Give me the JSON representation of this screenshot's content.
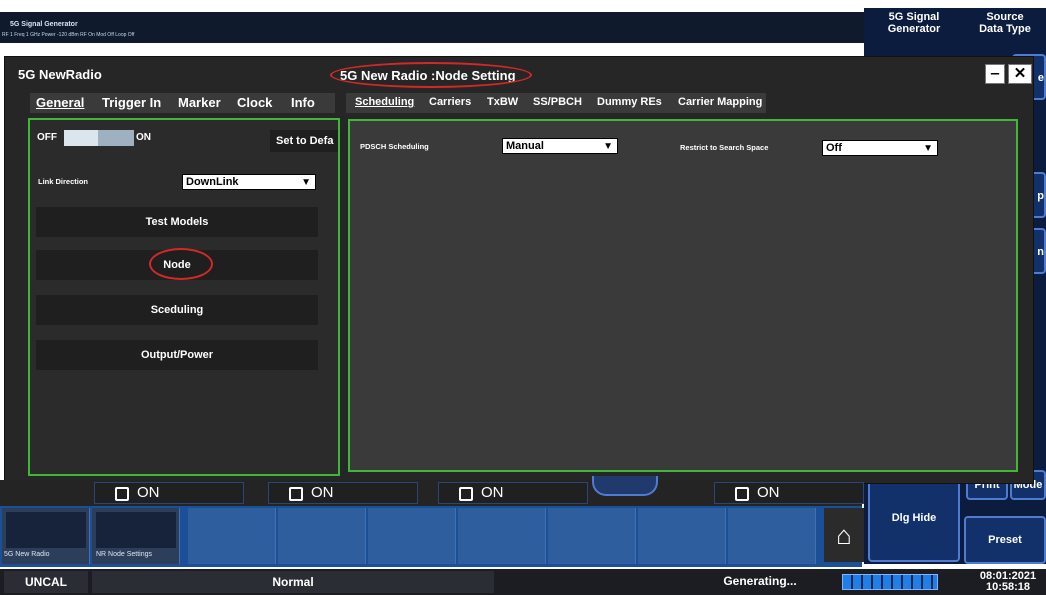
{
  "header": {
    "window_label": "5G Signal Generator",
    "status_line": "RF 1 Freq 1 GHz Power -120 dBm RF On Mod Off Loop Off"
  },
  "right_panel": {
    "btn1": "5G Signal\nGenerator",
    "btn2": "Source\nData Type",
    "frag1": "e",
    "frag2": "p",
    "frag3": "n",
    "print": "Print",
    "mode": "Mode",
    "dlg_hide": "Dlg Hide",
    "preset": "Preset"
  },
  "dialog": {
    "title": "5G NewRadio",
    "node_title": "5G New Radio :Node Setting",
    "min_icon": "‒",
    "close_icon": "✕"
  },
  "left_tabs": [
    "General",
    "Trigger In",
    "Marker",
    "Clock",
    "Info"
  ],
  "right_tabs": [
    "Scheduling",
    "Carriers",
    "TxBW",
    "SS/PBCH",
    "Dummy REs",
    "Carrier Mapping"
  ],
  "left_panel": {
    "off": "OFF",
    "on": "ON",
    "set_default": "Set to Defa",
    "link_label": "Link Direction",
    "link_value": "DownLink",
    "test_models": "Test Models",
    "node": "Node",
    "sceduling": "Sceduling",
    "output_power": "Output/Power"
  },
  "right_panel_content": {
    "pdsch_label": "PDSCH Scheduling",
    "pdsch_value": "Manual",
    "restrict_label": "Restrict to Search Space",
    "restrict_value": "Off",
    "arrow": "▼"
  },
  "softkeys": {
    "on1": "ON",
    "on2": "ON",
    "on3": "ON",
    "on4": "ON"
  },
  "thumbs": {
    "t1": "5G New Radio",
    "t2": "NR Node Settings",
    "home_icon": "⌂"
  },
  "status_bar": {
    "uncal": "UNCAL",
    "normal": "Normal",
    "generating": "Generating...",
    "date": "08:01:2021",
    "time": "10:58:18"
  }
}
